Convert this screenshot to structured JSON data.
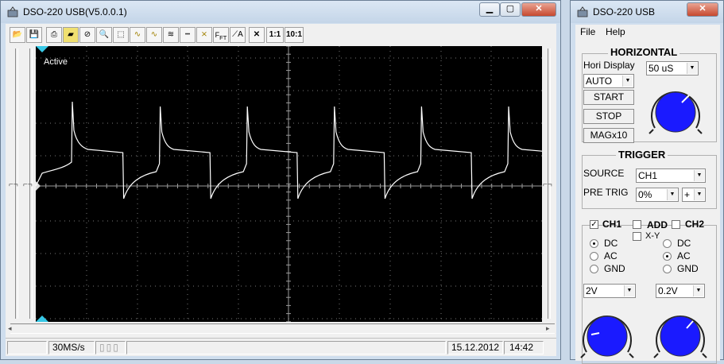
{
  "scope_window": {
    "title": "DSO-220 USB(V5.0.0.1)",
    "toolbar": {
      "ratio_1": "1:1",
      "ratio_10": "10:1"
    },
    "screen": {
      "status_label": "Active"
    },
    "statusbar": {
      "sample_rate": "30MS/s",
      "date": "15.12.2012",
      "time": "14:42"
    }
  },
  "control_window": {
    "title": "DSO-220 USB",
    "menu": [
      "File",
      "Help"
    ],
    "horizontal": {
      "title": "HORIZONTAL",
      "hori_display_label": "Hori Display",
      "hori_display_value": "AUTO",
      "timebase_value": "50 uS",
      "start_label": "START",
      "stop_label": "STOP",
      "mag_label": "MAGx10"
    },
    "trigger": {
      "title": "TRIGGER",
      "source_label": "SOURCE",
      "source_value": "CH1",
      "pretrig_label": "PRE TRIG",
      "pretrig_value": "0%",
      "slope_value": "+"
    },
    "channels": {
      "ch1_label": "CH1",
      "add_label": "ADD",
      "ch2_label": "CH2",
      "xy_label": "X-Y",
      "ch1_coupling": [
        "DC",
        "AC",
        "GND"
      ],
      "ch1_selected": "DC",
      "ch1_volts": "2V",
      "ch2_coupling": [
        "DC",
        "AC",
        "GND"
      ],
      "ch2_selected": "AC",
      "ch2_volts": "0.2V"
    }
  },
  "colors": {
    "knob_blue": "#1a1aff",
    "trace": "#ffffff",
    "marker_cyan": "#37c8e6"
  }
}
